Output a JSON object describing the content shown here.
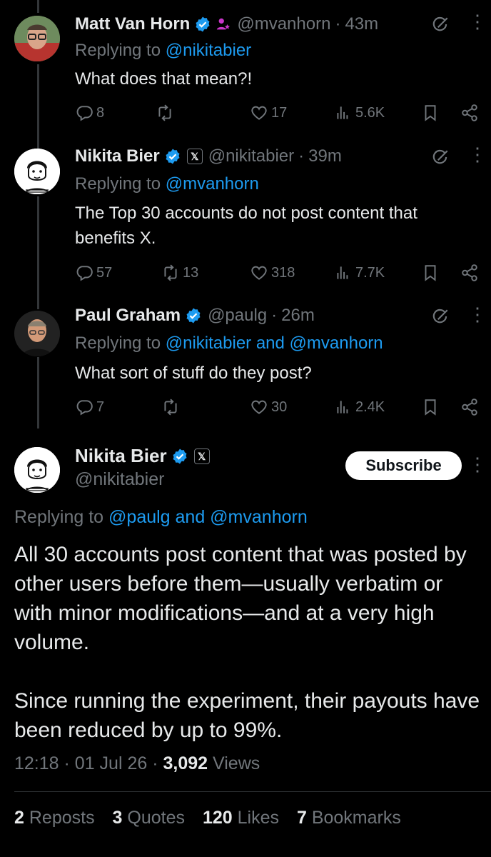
{
  "replies": [
    {
      "name": "Matt Van Horn",
      "handle": "@mvanhorn",
      "time": "43m",
      "replying_prefix": "Replying to",
      "replying_to": "@nikitabier",
      "text": "What does that mean?!",
      "replies": "8",
      "reposts": "",
      "likes": "17",
      "views": "5.6K"
    },
    {
      "name": "Nikita Bier",
      "handle": "@nikitabier",
      "time": "39m",
      "replying_prefix": "Replying to",
      "replying_to": "@mvanhorn",
      "text": "The Top 30 accounts do not post content that benefits X.",
      "replies": "57",
      "reposts": "13",
      "likes": "318",
      "views": "7.7K"
    },
    {
      "name": "Paul Graham",
      "handle": "@paulg",
      "time": "26m",
      "replying_prefix": "Replying to",
      "replying_to": "@nikitabier and @mvanhorn",
      "text": "What sort of stuff do they post?",
      "replies": "7",
      "reposts": "",
      "likes": "30",
      "views": "2.4K"
    }
  ],
  "main": {
    "name": "Nikita Bier",
    "handle": "@nikitabier",
    "subscribe_label": "Subscribe",
    "replying_prefix": "Replying to",
    "replying_to": "@paulg and @mvanhorn",
    "paragraph1": "All 30 accounts post content that was posted by other users before them—usually verbatim or with minor modifications—and at a very high volume.",
    "paragraph2": "Since running the experiment, their payouts have been reduced by up to 99%.",
    "time": "12:18",
    "date": "01 Jul 26",
    "views_count": "3,092",
    "views_label": "Views",
    "reposts_count": "2",
    "reposts_label": "Reposts",
    "quotes_count": "3",
    "quotes_label": "Quotes",
    "likes_count": "120",
    "likes_label": "Likes",
    "bookmarks_count": "7",
    "bookmarks_label": "Bookmarks"
  },
  "colors": {
    "background": "#000000",
    "text": "#e7e9ea",
    "muted": "#71767b",
    "link": "#1d9bf0",
    "verified": "#1d9bf0"
  }
}
